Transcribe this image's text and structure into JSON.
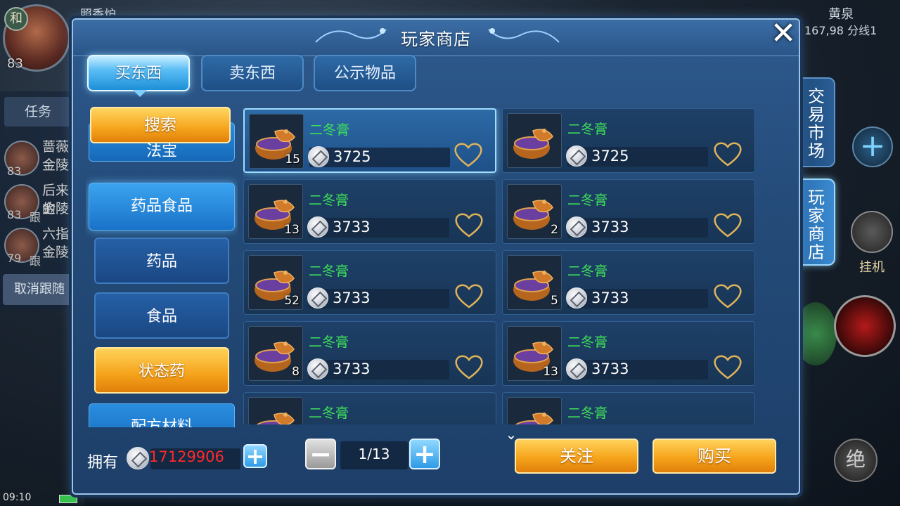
{
  "background": {
    "badge": "和",
    "player_level": "83",
    "top_title": "照香炉",
    "map_name": "黄泉",
    "coords": "167,98 分线1",
    "task_label": "任务",
    "party": [
      {
        "name": "蔷薇",
        "location": "金陵",
        "level": "83"
      },
      {
        "name": "后来的",
        "location": "金陵",
        "level": "83",
        "tag": "跟"
      },
      {
        "name": "六指",
        "location": "金陵",
        "level": "79",
        "tag": "跟"
      }
    ],
    "cancel_follow": "取消跟随",
    "clock": "09:10",
    "auto_label": "挂机",
    "orb_label": "绝"
  },
  "dialog": {
    "title": "玩家商店",
    "close_icon": "close-icon"
  },
  "tabs": [
    {
      "label": "买东西",
      "active": true
    },
    {
      "label": "卖东西",
      "active": false
    },
    {
      "label": "公示物品",
      "active": false
    }
  ],
  "sidebar": {
    "search_label": "搜索",
    "items": [
      {
        "label": "法宝",
        "type": "main"
      },
      {
        "label": "药品食品",
        "type": "main"
      },
      {
        "label": "药品",
        "type": "sub"
      },
      {
        "label": "食品",
        "type": "sub"
      },
      {
        "label": "状态药",
        "type": "sub",
        "selected": true
      },
      {
        "label": "配方材料",
        "type": "main"
      }
    ]
  },
  "listings": [
    {
      "name": "二冬膏",
      "price": "3725",
      "qty": "15",
      "selected": true
    },
    {
      "name": "二冬膏",
      "price": "3725",
      "qty": ""
    },
    {
      "name": "二冬膏",
      "price": "3733",
      "qty": "13"
    },
    {
      "name": "二冬膏",
      "price": "3733",
      "qty": "2"
    },
    {
      "name": "二冬膏",
      "price": "3733",
      "qty": "52"
    },
    {
      "name": "二冬膏",
      "price": "3733",
      "qty": "5"
    },
    {
      "name": "二冬膏",
      "price": "3733",
      "qty": "8"
    },
    {
      "name": "二冬膏",
      "price": "3733",
      "qty": "13"
    },
    {
      "name": "二冬膏",
      "price": "",
      "qty": ""
    },
    {
      "name": "二冬膏",
      "price": "",
      "qty": ""
    }
  ],
  "footer": {
    "own_label": "拥有",
    "own_amount": "17129906",
    "page": "1/13",
    "follow_label": "关注",
    "buy_label": "购买"
  },
  "side_tabs": [
    {
      "label_chars": [
        "交",
        "易",
        "市",
        "场"
      ],
      "active": false
    },
    {
      "label_chars": [
        "玩",
        "家",
        "商",
        "店"
      ],
      "active": true
    }
  ],
  "colors": {
    "accent_orange": "#f6a41c",
    "item_name_green": "#3ee05a",
    "owned_amount_red": "#ff2a2a",
    "panel_blue": "#244b79"
  }
}
